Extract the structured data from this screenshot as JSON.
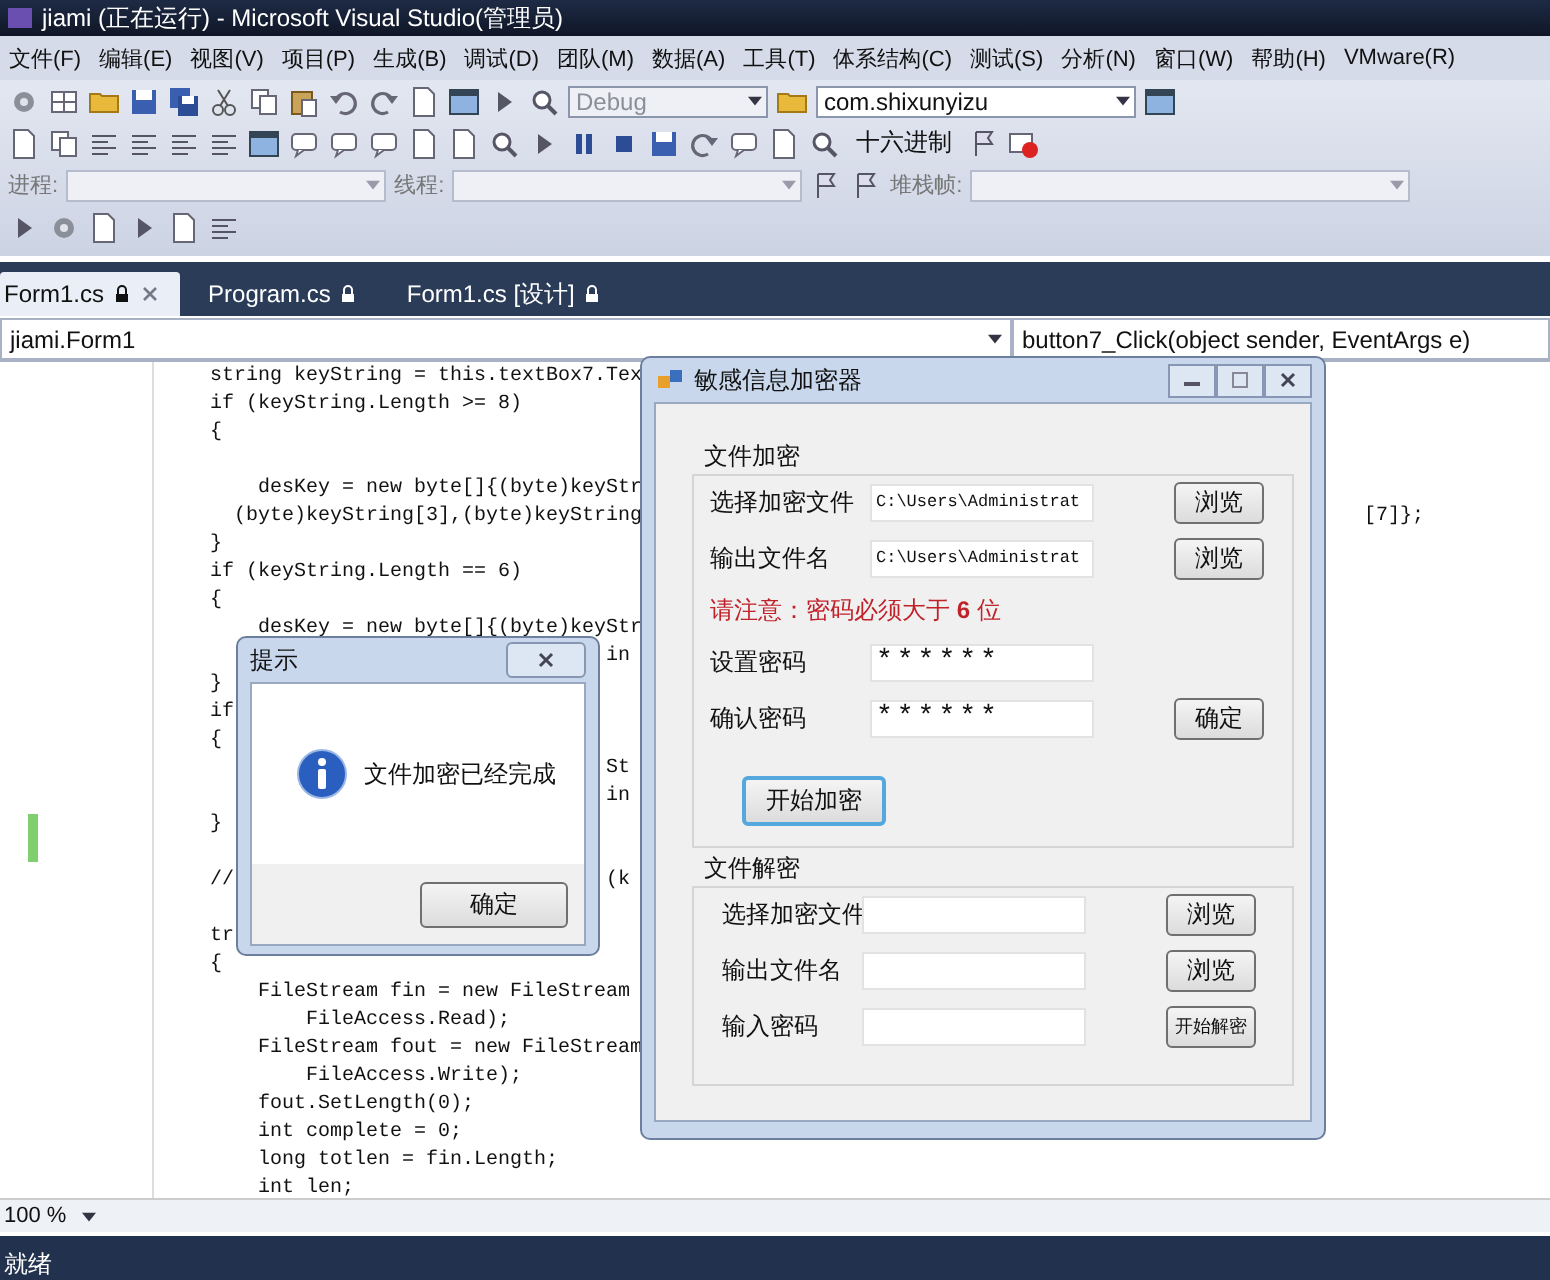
{
  "window": {
    "title": "jiami (正在运行) - Microsoft Visual Studio(管理员)"
  },
  "menu": [
    "文件(F)",
    "编辑(E)",
    "视图(V)",
    "项目(P)",
    "生成(B)",
    "调试(D)",
    "团队(M)",
    "数据(A)",
    "工具(T)",
    "体系结构(C)",
    "测试(S)",
    "分析(N)",
    "窗口(W)",
    "帮助(H)",
    "VMware(R)"
  ],
  "toolbar": {
    "config": "Debug",
    "project": "com.shixunyizu",
    "hex_button": "十六进制",
    "process_label": "进程:",
    "thread_label": "线程:",
    "stack_label": "堆栈帧:"
  },
  "tabs": [
    {
      "label": "Form1.cs",
      "selected": true,
      "closable": true
    },
    {
      "label": "Program.cs",
      "selected": false,
      "closable": false
    },
    {
      "label": "Form1.cs [设计]",
      "selected": false,
      "closable": false
    }
  ],
  "nav": {
    "class": "jiami.Form1",
    "member": "button7_Click(object sender, EventArgs e)"
  },
  "code": [
    {
      "left": "string keyString = this.textBox7.Tex"
    },
    {
      "left": "if (keyString.Length >= 8)"
    },
    {
      "left": "{"
    },
    {
      "left": "    desKey = new byte[]{(byte)keyStr",
      "blank_before": true
    },
    {
      "left": "  (byte)keyString[3],(byte)keyString",
      "right": "[7]};"
    },
    {
      "left": "}"
    },
    {
      "left": "if (keyString.Length == 6)"
    },
    {
      "left": "{"
    },
    {
      "left": "    desKey = new byte[]{(byte)keyStr"
    },
    {
      "mid": "in"
    },
    {
      "left": "}"
    },
    {
      "left": "if"
    },
    {
      "left": "{"
    },
    {
      "mid": "St"
    },
    {
      "mid": "in"
    },
    {
      "left": "}"
    },
    {
      "left": "//",
      "mid": "(k",
      "blank_before": true
    },
    {
      "left": "tr",
      "blank_before": true
    },
    {
      "left": "{"
    },
    {
      "left": "    FileStream fin = new FileStream"
    },
    {
      "left": "        FileAccess.Read);"
    },
    {
      "left": "    FileStream fout = new FileStream"
    },
    {
      "left": "        FileAccess.Write);"
    },
    {
      "left": "    fout.SetLength(0);"
    },
    {
      "left": "    int complete = 0;"
    },
    {
      "left": "    long totlen = fin.Length;"
    },
    {
      "left": "    int len;"
    }
  ],
  "zoom": "100 %",
  "status_bar": "就绪",
  "message_box": {
    "title": "提示",
    "message": "文件加密已经完成",
    "button": "确定"
  },
  "encrypt_window": {
    "title": "敏感信息加密器",
    "groups": [
      {
        "label": "文件加密",
        "items": [
          {
            "kind": "field",
            "label": "选择加密文件",
            "value": "C:\\Users\\Administrat",
            "button": "浏览"
          },
          {
            "kind": "field",
            "label": "输出文件名",
            "value": "C:\\Users\\Administrat",
            "button": "浏览"
          },
          {
            "kind": "note",
            "text": "请注意：密码必须大于 **6** 位"
          },
          {
            "kind": "field",
            "label": "设置密码",
            "value": "******"
          },
          {
            "kind": "field",
            "label": "确认密码",
            "value": "******",
            "button": "确定"
          },
          {
            "kind": "action",
            "text": "开始加密"
          }
        ]
      },
      {
        "label": "文件解密",
        "items": [
          {
            "kind": "field",
            "label": "选择加密文件",
            "button": "浏览"
          },
          {
            "kind": "field",
            "label": "输出文件名",
            "button": "浏览"
          },
          {
            "kind": "field",
            "label": "输入密码",
            "button": "开始解密"
          }
        ]
      }
    ]
  }
}
